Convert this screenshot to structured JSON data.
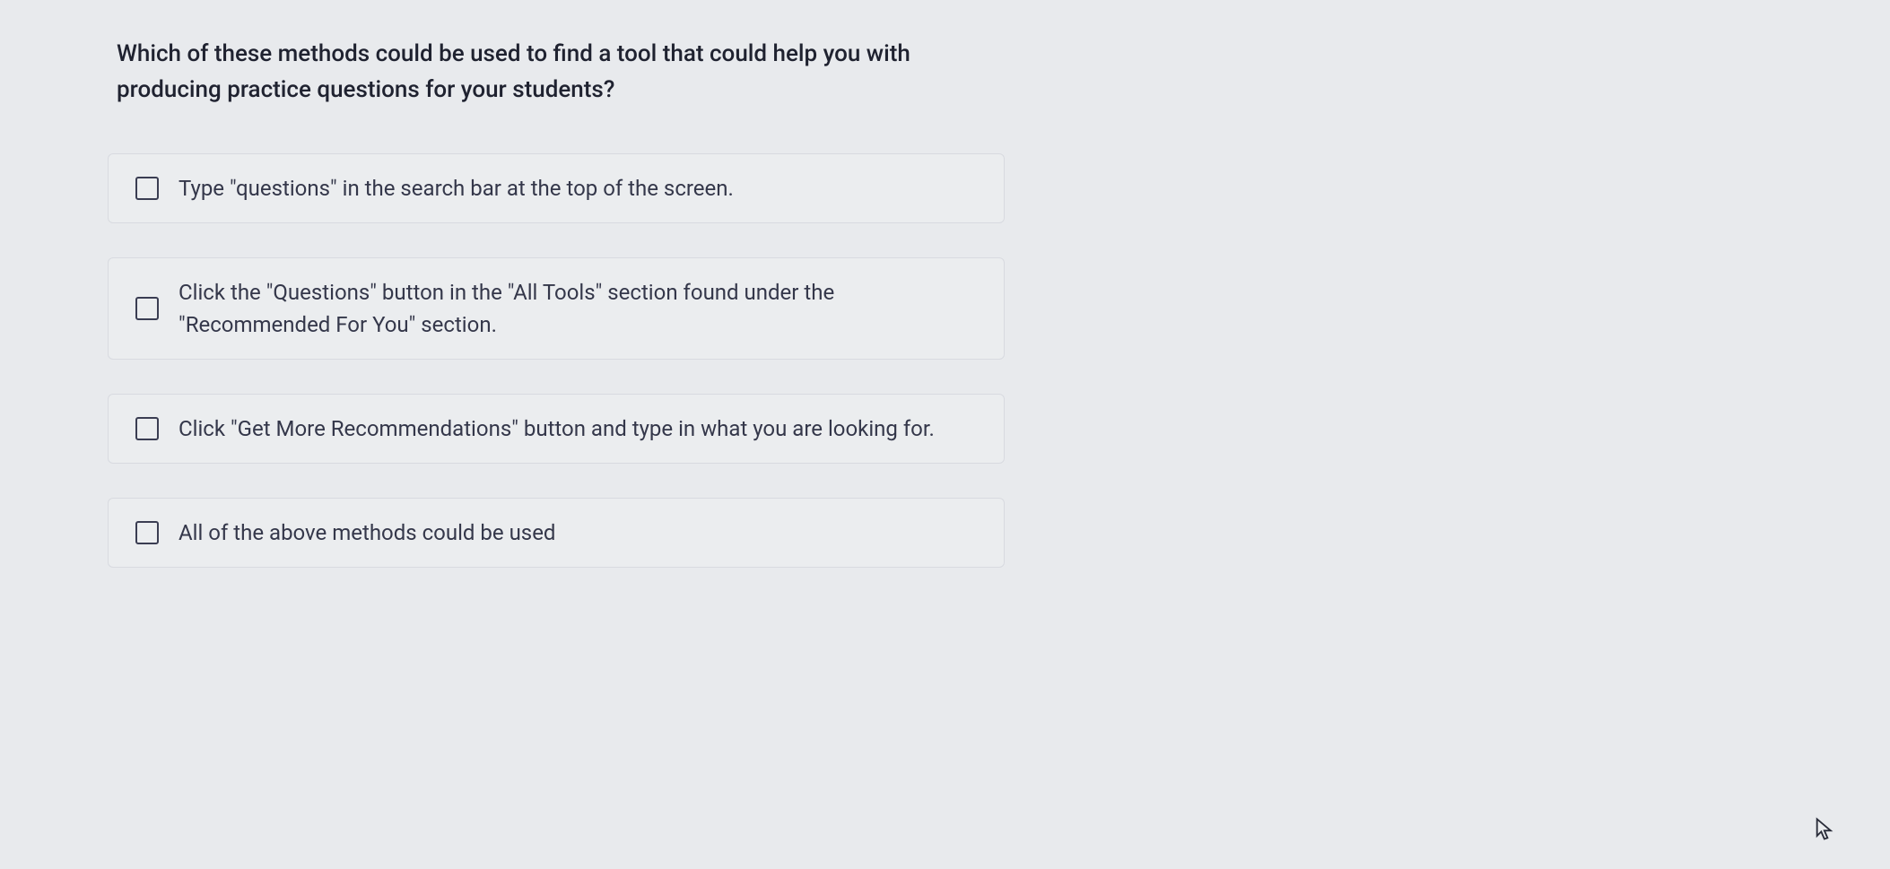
{
  "question": "Which of these methods could be used to find a tool that could help you with producing practice questions for your students?",
  "options": [
    {
      "label": "Type \"questions\" in the search bar at the top of the screen."
    },
    {
      "label": "Click the \"Questions\" button in the \"All Tools\" section found under the \"Recommended For You\" section."
    },
    {
      "label": "Click \"Get More Recommendations\" button and type in what you are looking for."
    },
    {
      "label": "All of the above methods could be used"
    }
  ]
}
